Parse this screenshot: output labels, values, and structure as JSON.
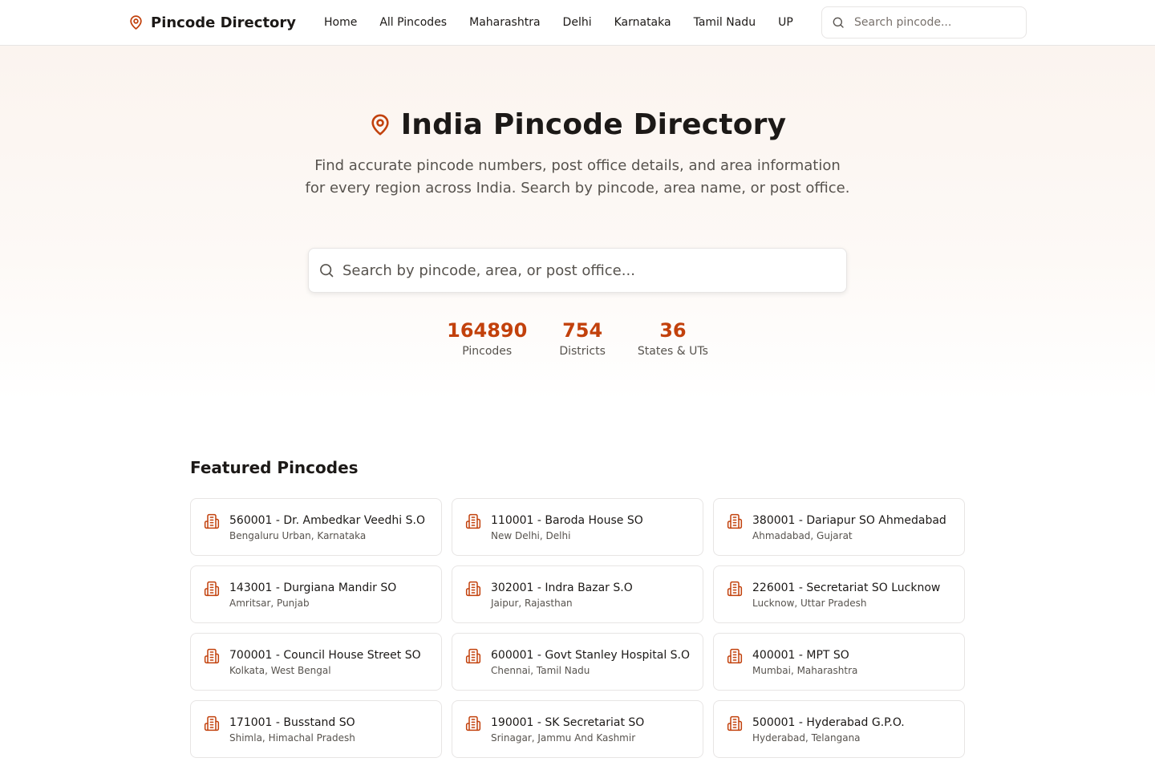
{
  "header": {
    "brand": "Pincode Directory",
    "nav": [
      "Home",
      "All Pincodes",
      "Maharashtra",
      "Delhi",
      "Karnataka",
      "Tamil Nadu",
      "UP"
    ],
    "search_placeholder": "Search pincode..."
  },
  "hero": {
    "title": "India Pincode Directory",
    "subtitle": "Find accurate pincode numbers, post office details, and area information for every region across India. Search by pincode, area name, or post office.",
    "search_placeholder": "Search by pincode, area, or post office...",
    "stats": [
      {
        "value": "164890",
        "label": "Pincodes"
      },
      {
        "value": "754",
        "label": "Districts"
      },
      {
        "value": "36",
        "label": "States & UTs"
      }
    ]
  },
  "featured": {
    "title": "Featured Pincodes",
    "items": [
      {
        "title": "560001 - Dr. Ambedkar Veedhi S.O",
        "location": "Bengaluru Urban, Karnataka"
      },
      {
        "title": "110001 - Baroda House SO",
        "location": "New Delhi, Delhi"
      },
      {
        "title": "380001 - Dariapur SO Ahmedabad",
        "location": "Ahmadabad, Gujarat"
      },
      {
        "title": "143001 - Durgiana Mandir SO",
        "location": "Amritsar, Punjab"
      },
      {
        "title": "302001 - Indra Bazar S.O",
        "location": "Jaipur, Rajasthan"
      },
      {
        "title": "226001 - Secretariat SO Lucknow",
        "location": "Lucknow, Uttar Pradesh"
      },
      {
        "title": "700001 - Council House Street SO",
        "location": "Kolkata, West Bengal"
      },
      {
        "title": "600001 - Govt Stanley Hospital S.O",
        "location": "Chennai, Tamil Nadu"
      },
      {
        "title": "400001 - MPT SO",
        "location": "Mumbai, Maharashtra"
      },
      {
        "title": "171001 - Busstand SO",
        "location": "Shimla, Himachal Pradesh"
      },
      {
        "title": "190001 - SK Secretariat SO",
        "location": "Srinagar, Jammu And Kashmir"
      },
      {
        "title": "500001 - Hyderabad G.P.O.",
        "location": "Hyderabad, Telangana"
      }
    ]
  },
  "icons": {
    "brand": "map-pin-icon",
    "search": "search-icon",
    "card": "building-icon"
  },
  "colors": {
    "accent": "#c2410c",
    "text": "#1c1917",
    "muted": "#57534e",
    "border": "#e7e5e4"
  }
}
